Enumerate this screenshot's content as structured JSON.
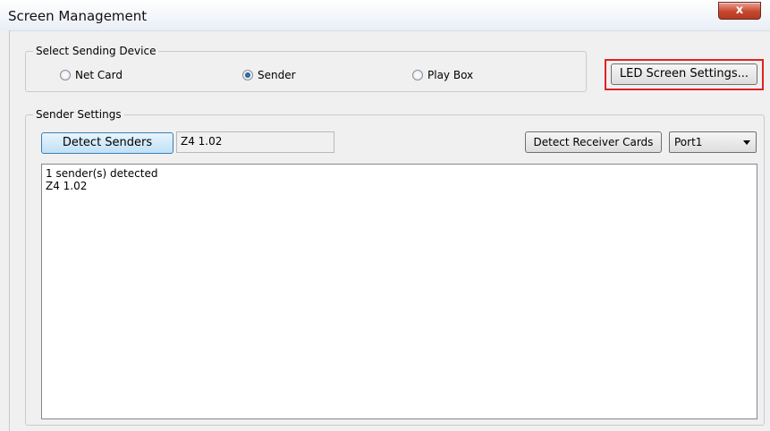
{
  "window": {
    "title": "Screen Management",
    "close_label": "x"
  },
  "sending_device": {
    "legend": "Select Sending Device",
    "options": [
      {
        "label": "Net Card",
        "checked": false
      },
      {
        "label": "Sender",
        "checked": true
      },
      {
        "label": "Play Box",
        "checked": false
      }
    ],
    "led_settings_button": "LED Screen Settings..."
  },
  "sender_settings": {
    "legend": "Sender Settings",
    "detect_senders_button": "Detect Senders",
    "detected_device_value": "Z4 1.02",
    "detect_receiver_button": "Detect Receiver Cards",
    "port_select": {
      "selected": "Port1"
    },
    "log_lines": [
      "1 sender(s) detected",
      "Z4 1.02"
    ]
  },
  "colors": {
    "highlight": "#e32020",
    "close_button": "#c8472e",
    "primary_button_border": "#3c7fb1"
  }
}
